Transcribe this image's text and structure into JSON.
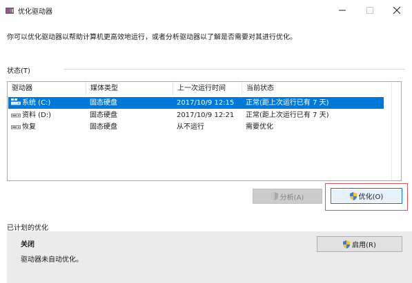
{
  "window": {
    "title": "优化驱动器",
    "app_icon": "defrag-icon",
    "controls": [
      "minimize-icon",
      "maximize-icon",
      "close-icon"
    ]
  },
  "description": "你可以优化驱动器以帮助计算机更高效地运行，或者分析驱动器以了解是否需要对其进行优化。",
  "status": {
    "header": "状态(T)",
    "columns": [
      "驱动器",
      "媒体类型",
      "上一次运行时间",
      "当前状态"
    ],
    "drives": [
      {
        "name": "系统 (C:)",
        "icon": "system-drive-icon",
        "media": "固态硬盘",
        "last_run": "2017/10/9 12:15",
        "state": "正常(距上次运行已有 7 天)",
        "selected": true
      },
      {
        "name": "资料 (D:)",
        "icon": "drive-icon",
        "media": "固态硬盘",
        "last_run": "2017/10/9 12:21",
        "state": "正常(距上次运行已有 7 天)",
        "selected": false
      },
      {
        "name": "恢复",
        "icon": "drive-icon",
        "media": "固态硬盘",
        "last_run": "从不运行",
        "state": "需要优化",
        "selected": false
      }
    ]
  },
  "actions": {
    "analyze_label": "分析(A)",
    "analyze_enabled": false,
    "optimize_label": "优化(O)",
    "button_icon": "uac-shield-icon",
    "highlight_color": "#d6575a"
  },
  "schedule": {
    "header": "已计划的优化",
    "state": "关闭",
    "description": "驱动器未自动优化。",
    "enable_label": "启用(R)"
  },
  "colors": {
    "selection": "#0078d7",
    "accent_border": "#0078d7"
  }
}
